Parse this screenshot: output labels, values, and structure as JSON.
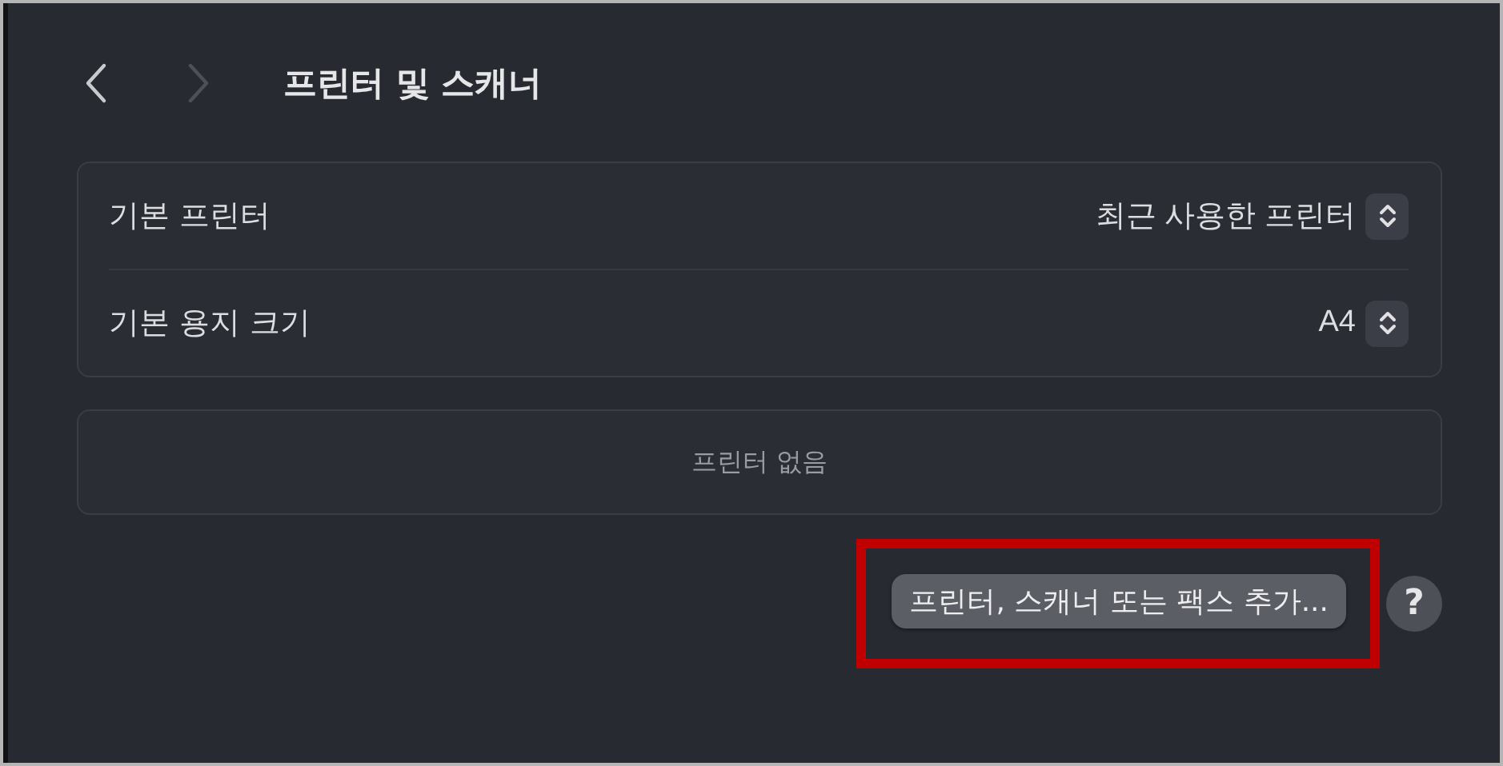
{
  "header": {
    "back": {
      "disabled": false
    },
    "forward": {
      "disabled": true
    },
    "title": "프린터 및 스캐너"
  },
  "settings": [
    {
      "label": "기본 프린터",
      "value": "최근 사용한 프린터"
    },
    {
      "label": "기본 용지 크기",
      "value": "A4"
    }
  ],
  "printer_list": {
    "empty_text": "프린터 없음"
  },
  "add_button": {
    "label": "프린터, 스캐너 또는 팩스 추가...",
    "highlighted": true
  },
  "help_button": {
    "label": "?"
  }
}
